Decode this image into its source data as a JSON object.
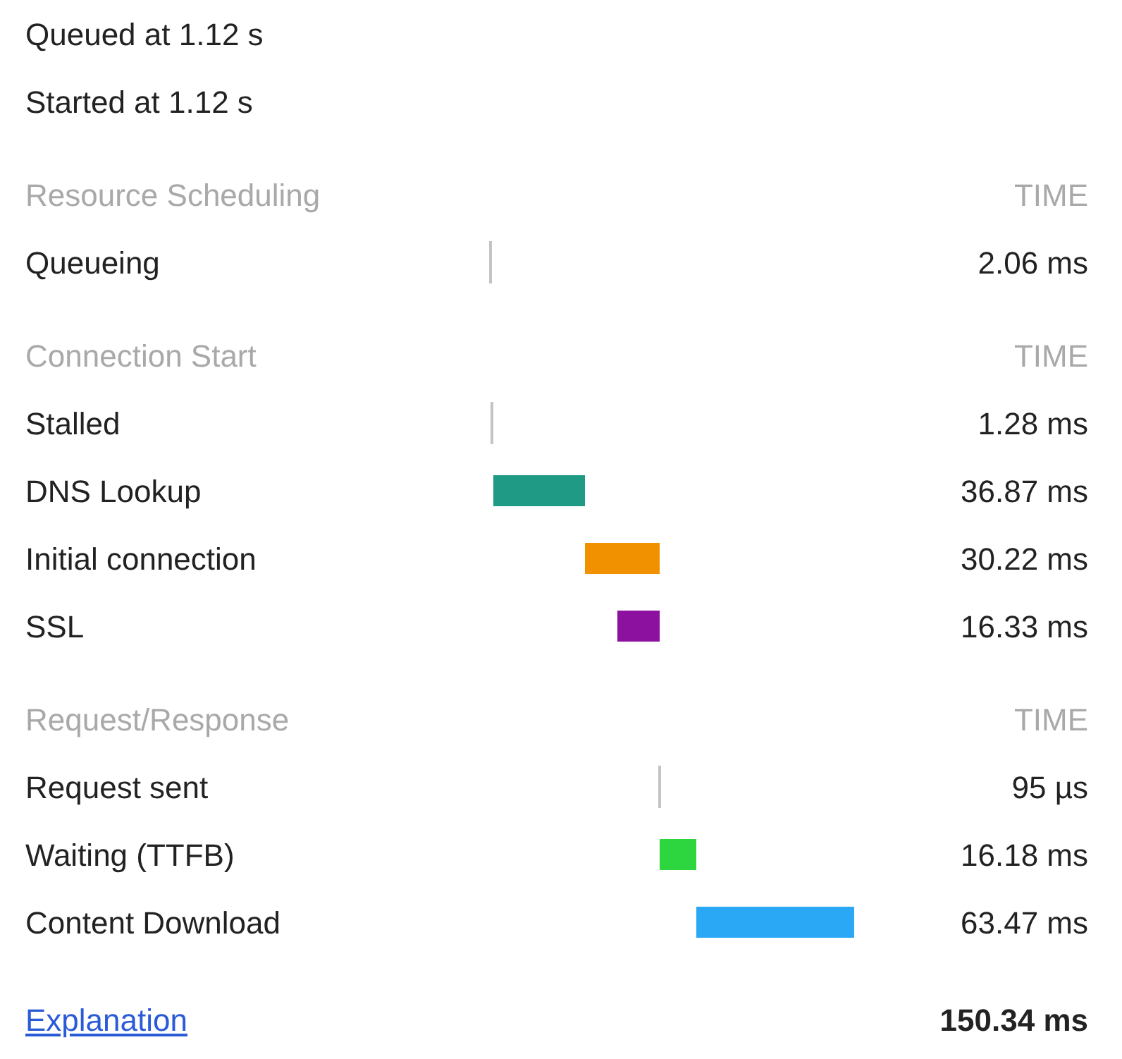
{
  "summary": [
    "Queued at 1.12 s",
    "Started at 1.12 s"
  ],
  "sections": [
    {
      "title": "Resource Scheduling",
      "time_header": "TIME",
      "rows": [
        {
          "label": "Queueing",
          "value": "2.06 ms",
          "kind": "tick",
          "color": "#c4c4c4"
        }
      ]
    },
    {
      "title": "Connection Start",
      "time_header": "TIME",
      "rows": [
        {
          "label": "Stalled",
          "value": "1.28 ms",
          "kind": "tick",
          "color": "#c4c4c4"
        },
        {
          "label": "DNS Lookup",
          "value": "36.87 ms",
          "kind": "bar",
          "color": "#1f9a84"
        },
        {
          "label": "Initial connection",
          "value": "30.22 ms",
          "kind": "bar",
          "color": "#f29100"
        },
        {
          "label": "SSL",
          "value": "16.33 ms",
          "kind": "bar",
          "color": "#8b119e"
        }
      ]
    },
    {
      "title": "Request/Response",
      "time_header": "TIME",
      "rows": [
        {
          "label": "Request sent",
          "value": "95 µs",
          "kind": "tick",
          "color": "#c4c4c4"
        },
        {
          "label": "Waiting (TTFB)",
          "value": "16.18 ms",
          "kind": "bar",
          "color": "#2dd53e"
        },
        {
          "label": "Content Download",
          "value": "63.47 ms",
          "kind": "bar",
          "color": "#2ba8f5"
        }
      ]
    }
  ],
  "footer": {
    "link": "Explanation",
    "total": "150.34 ms"
  }
}
